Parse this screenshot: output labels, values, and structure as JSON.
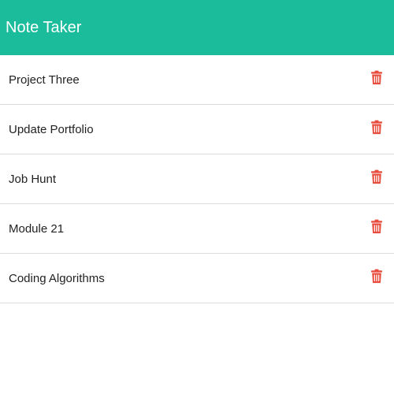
{
  "header": {
    "title": "Note Taker"
  },
  "notes": [
    {
      "title": "Project Three",
      "icon": "trash-icon"
    },
    {
      "title": "Update Portfolio",
      "icon": "trash-icon"
    },
    {
      "title": "Job Hunt",
      "icon": "trash-icon"
    },
    {
      "title": "Module 21",
      "icon": "trash-icon"
    },
    {
      "title": "Coding Algorithms",
      "icon": "trash-icon"
    }
  ],
  "colors": {
    "header_bg": "#1abc9c",
    "header_text": "#ffffff",
    "delete_icon": "#e74c3c",
    "divider": "#dcdcdc"
  }
}
